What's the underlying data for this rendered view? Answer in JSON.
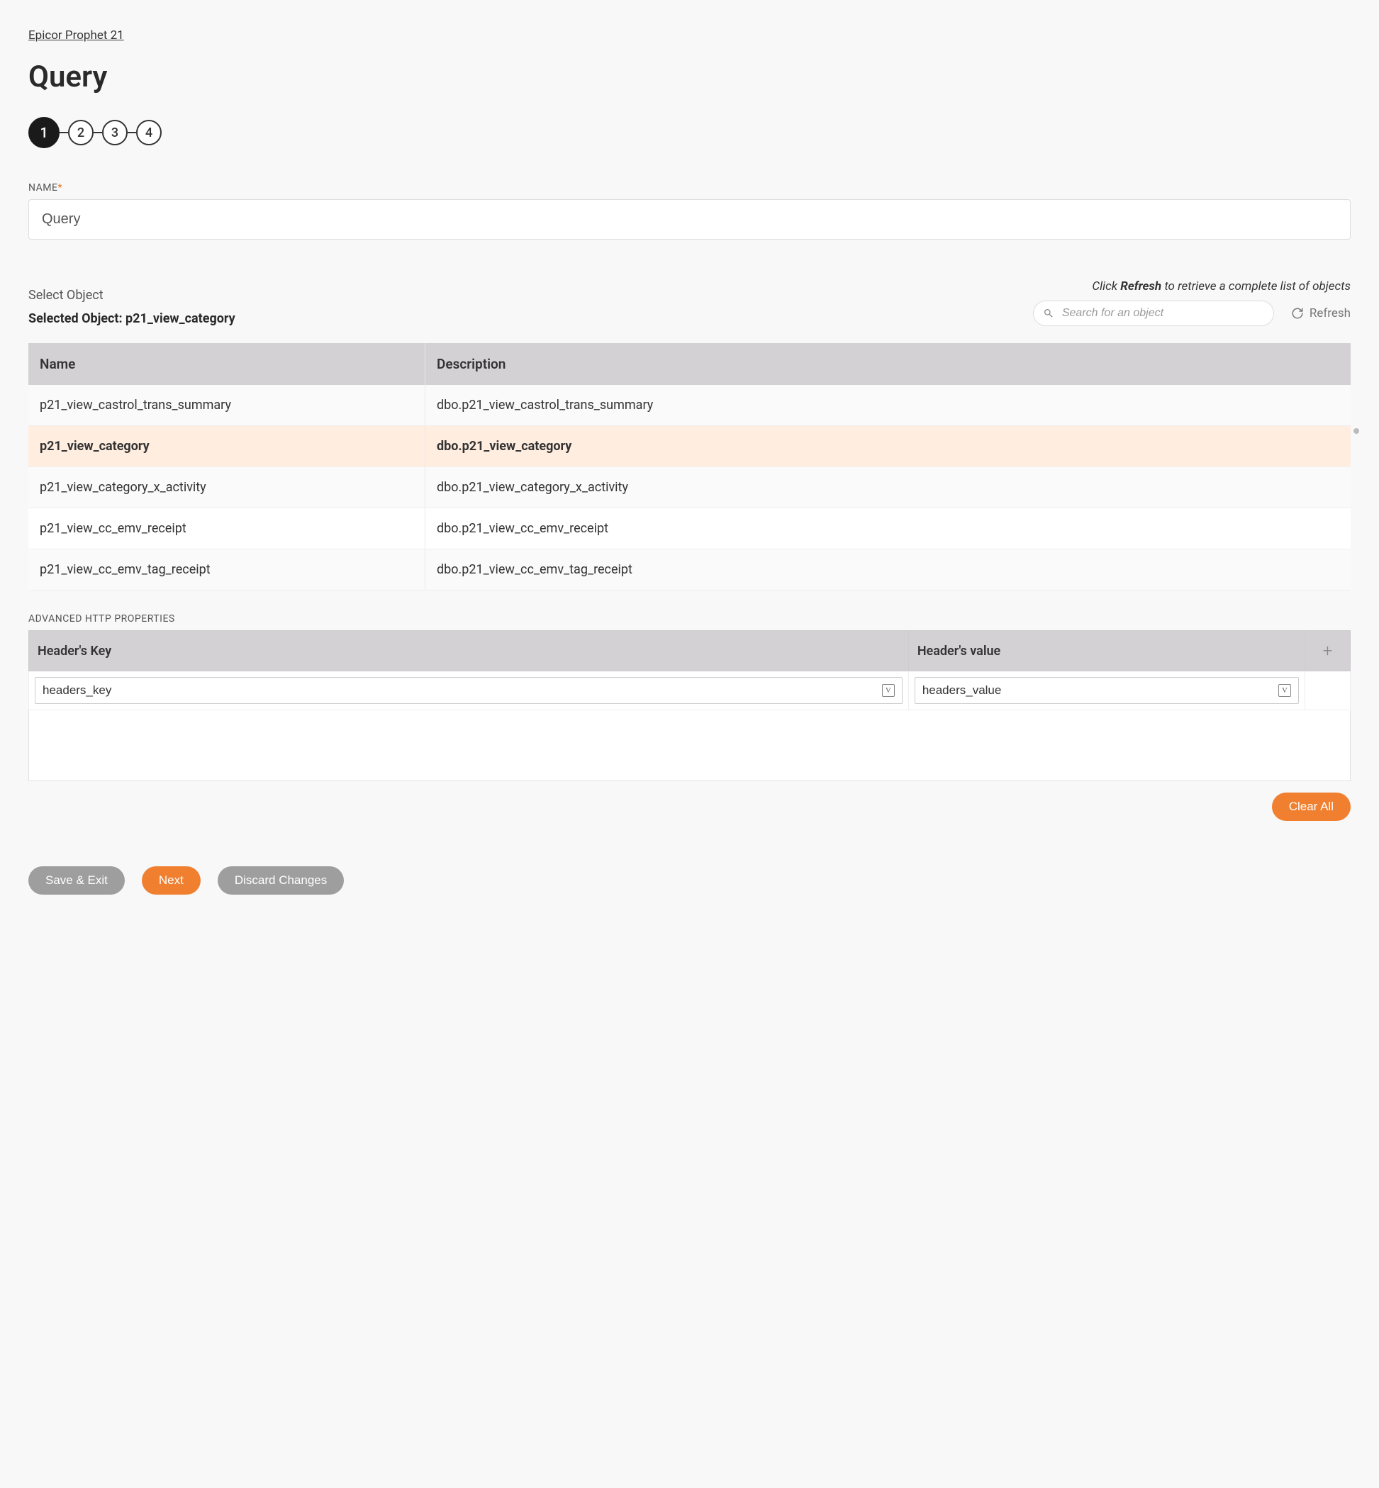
{
  "breadcrumb": "Epicor Prophet 21",
  "page_title": "Query",
  "stepper": {
    "steps": [
      "1",
      "2",
      "3",
      "4"
    ],
    "active_index": 0
  },
  "name_field": {
    "label": "NAME",
    "required": "*",
    "value": "Query"
  },
  "object_section": {
    "select_label": "Select Object",
    "selected_prefix": "Selected Object: ",
    "selected_value": "p21_view_category",
    "hint_pre": "Click ",
    "hint_bold": "Refresh",
    "hint_post": " to retrieve a complete list of objects",
    "search_placeholder": "Search for an object",
    "refresh_label": "Refresh"
  },
  "object_table": {
    "headers": {
      "name": "Name",
      "description": "Description"
    },
    "rows": [
      {
        "name": "p21_view_castrol_trans_summary",
        "description": "dbo.p21_view_castrol_trans_summary",
        "selected": false
      },
      {
        "name": "p21_view_category",
        "description": "dbo.p21_view_category",
        "selected": true
      },
      {
        "name": "p21_view_category_x_activity",
        "description": "dbo.p21_view_category_x_activity",
        "selected": false
      },
      {
        "name": "p21_view_cc_emv_receipt",
        "description": "dbo.p21_view_cc_emv_receipt",
        "selected": false
      },
      {
        "name": "p21_view_cc_emv_tag_receipt",
        "description": "dbo.p21_view_cc_emv_tag_receipt",
        "selected": false
      }
    ]
  },
  "advanced": {
    "label": "ADVANCED HTTP PROPERTIES",
    "headers": {
      "key": "Header's Key",
      "value": "Header's value"
    },
    "row": {
      "key": "headers_key",
      "value": "headers_value"
    }
  },
  "buttons": {
    "clear_all": "Clear All",
    "save_exit": "Save & Exit",
    "next": "Next",
    "discard": "Discard Changes"
  }
}
